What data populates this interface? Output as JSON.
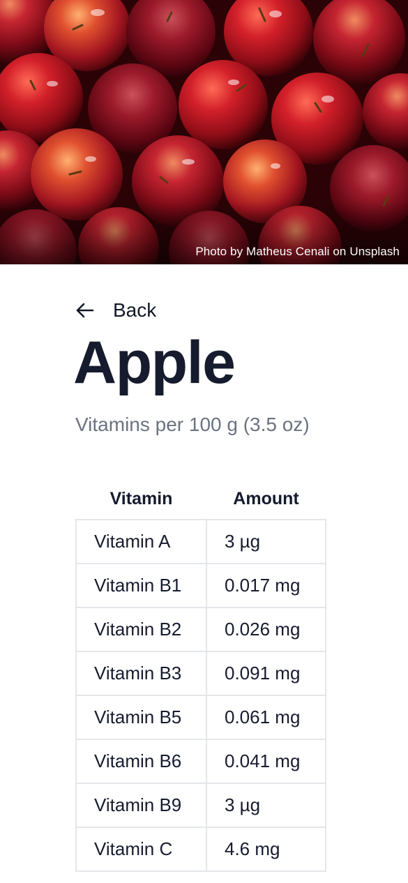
{
  "hero": {
    "photo_credit": "Photo by Matheus Cenali on Unsplash"
  },
  "nav": {
    "back_label": "Back",
    "back_icon": "arrow-left-icon"
  },
  "page": {
    "title": "Apple",
    "subtitle": "Vitamins per 100 g (3.5 oz)"
  },
  "table": {
    "headers": [
      "Vitamin",
      "Amount"
    ],
    "rows": [
      {
        "vitamin": "Vitamin A",
        "amount": "3 µg"
      },
      {
        "vitamin": "Vitamin B1",
        "amount": "0.017 mg"
      },
      {
        "vitamin": "Vitamin B2",
        "amount": "0.026 mg"
      },
      {
        "vitamin": "Vitamin B3",
        "amount": "0.091 mg"
      },
      {
        "vitamin": "Vitamin B5",
        "amount": "0.061 mg"
      },
      {
        "vitamin": "Vitamin B6",
        "amount": "0.041 mg"
      },
      {
        "vitamin": "Vitamin B9",
        "amount": "3 µg"
      },
      {
        "vitamin": "Vitamin C",
        "amount": "4.6 mg"
      }
    ]
  },
  "colors": {
    "title": "#161b2e",
    "subtitle": "#6b7280",
    "table_border": "#e4e6ea"
  }
}
